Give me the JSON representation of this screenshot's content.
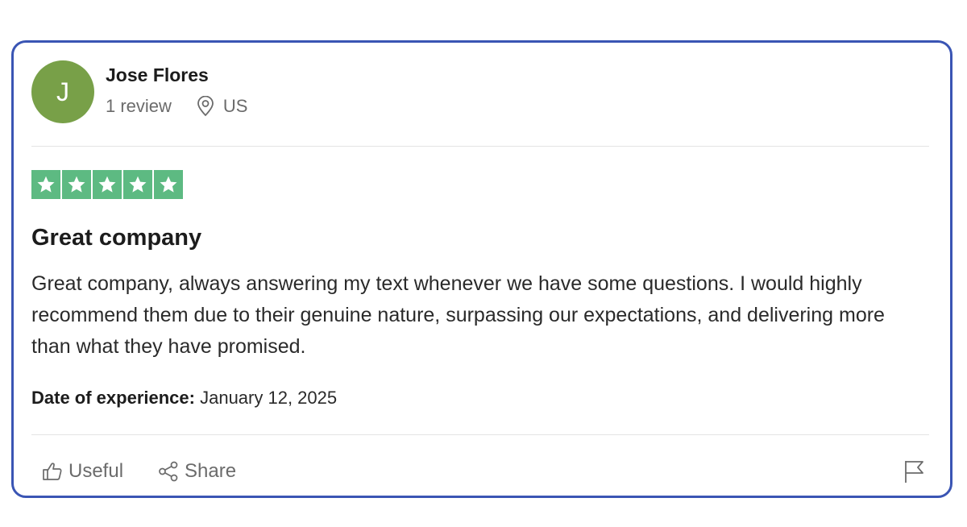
{
  "reviewer": {
    "initial": "J",
    "name": "Jose Flores",
    "review_count": "1 review",
    "country": "US",
    "avatar_color": "#78a048"
  },
  "rating": {
    "stars": 5,
    "max_stars": 5,
    "star_color": "#5dba82"
  },
  "review": {
    "title": "Great company",
    "body": "Great company, always answering my text whenever we have some questions. I would highly recommend them due to their genuine nature, surpassing our expectations, and delivering more than what they have promised."
  },
  "experience": {
    "label": "Date of experience:",
    "date": "January 12, 2025"
  },
  "actions": {
    "useful_label": "Useful",
    "share_label": "Share",
    "useful_icon": "thumbs-up-icon",
    "share_icon": "share-icon",
    "report_icon": "flag-icon"
  },
  "colors": {
    "card_border": "#3a55b4"
  }
}
